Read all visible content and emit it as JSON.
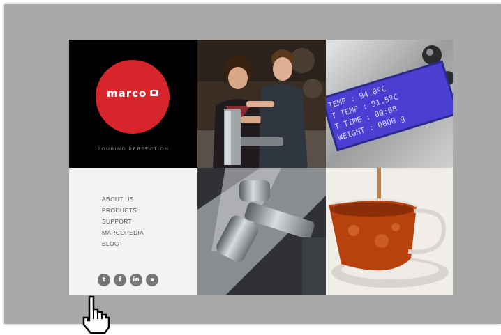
{
  "brand": {
    "logo_text": "marco",
    "tagline": "POURING PERFECTION",
    "accent_color": "#d7262b"
  },
  "nav": {
    "items": [
      {
        "label": "ABOUT US"
      },
      {
        "label": "PRODUCTS"
      },
      {
        "label": "SUPPORT"
      },
      {
        "label": "MARCOPEDIA"
      },
      {
        "label": "BLOG"
      }
    ]
  },
  "social": [
    {
      "icon": "twitter-icon",
      "glyph": "t"
    },
    {
      "icon": "facebook-icon",
      "glyph": "f"
    },
    {
      "icon": "linkedin-icon",
      "glyph": "in"
    },
    {
      "icon": "cup-icon",
      "glyph": "▪"
    }
  ],
  "display": {
    "lines": [
      "TEMP :  94.0ºC",
      "T TEMP :  91.5ºC",
      "T TIME :  00:08",
      "WEIGHT :  0000 g"
    ],
    "color": "#4a3fd1"
  }
}
